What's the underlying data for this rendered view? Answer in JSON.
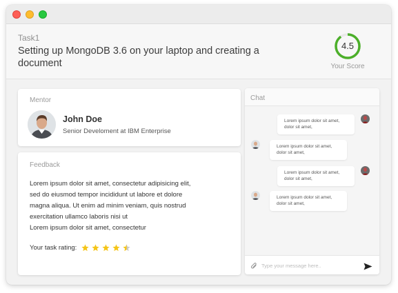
{
  "task": {
    "label": "Task1",
    "title": "Setting up MongoDB 3.6 on your laptop and creating a document"
  },
  "score": {
    "value": "4.5",
    "fraction": 0.9,
    "label": "Your Score",
    "ring_color": "#4caf2a",
    "track_color": "#e9e9e9"
  },
  "mentor": {
    "section_label": "Mentor",
    "name": "John Doe",
    "role": "Senior Develoment at IBM Enterprise"
  },
  "feedback": {
    "section_label": "Feedback",
    "text_line1": "Lorem ipsum dolor sit amet, consectetur adipisicing elit,",
    "text_line2": "sed do eiusmod tempor incididunt ut labore et dolore",
    "text_line3": "magna aliqua. Ut enim ad minim veniam, quis nostrud",
    "text_line4": "exercitation ullamco laboris nisi ut",
    "text_line5": "Lorem ipsum dolor sit amet, consectetur",
    "rating_label": "Your task rating:",
    "rating_value": 4.5,
    "rating_max": 5,
    "star_color": "#f5c518"
  },
  "chat": {
    "title": "Chat",
    "messages": [
      {
        "side": "right",
        "line1": "Lorem ipsum dolor sit amet,",
        "line2": "dolor sit amet,"
      },
      {
        "side": "left",
        "line1": "Lorem ipsum dolor sit amet,",
        "line2": "dolor sit amet,"
      },
      {
        "side": "right",
        "line1": "Lorem ipsum dolor sit amet,",
        "line2": "dolor sit amet,"
      },
      {
        "side": "left",
        "line1": "Lorem ipsum dolor sit amet,",
        "line2": "dolor sit amet,"
      }
    ],
    "input_placeholder": "Type your message here..",
    "input_value": ""
  }
}
